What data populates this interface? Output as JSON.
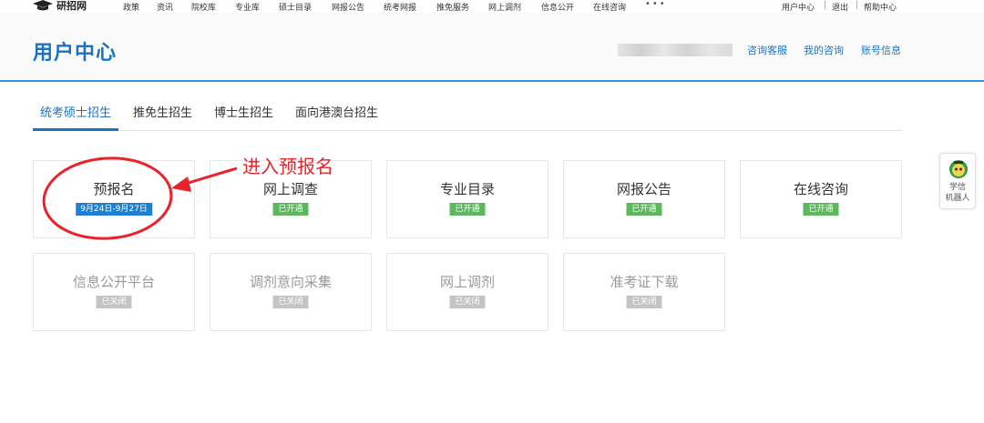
{
  "topnav": {
    "logo_text": "研招网",
    "links": [
      "政策",
      "资讯",
      "院校库",
      "专业库",
      "硕士目录",
      "网报公告",
      "统考网报",
      "推免服务",
      "网上调剂",
      "信息公开",
      "在线咨询"
    ],
    "more": "•••",
    "right": [
      "用户中心",
      "退出",
      "帮助中心"
    ],
    "sep": "|"
  },
  "header": {
    "title": "用户中心",
    "links": [
      "咨询客服",
      "我的咨询",
      "账号信息"
    ]
  },
  "tabs": [
    "统考硕士招生",
    "推免生招生",
    "博士生招生",
    "面向港澳台招生"
  ],
  "active_tab": 0,
  "cards_row1": [
    {
      "name": "预报名",
      "badge": "9月24日-9月27日"
    },
    {
      "name": "网上调查",
      "badge": "已开通"
    },
    {
      "name": "专业目录",
      "badge": "已开通"
    },
    {
      "name": "网报公告",
      "badge": "已开通"
    },
    {
      "name": "在线咨询",
      "badge": "已开通"
    }
  ],
  "cards_row2": [
    {
      "name": "信息公开平台",
      "badge": "已关闭"
    },
    {
      "name": "调剂意向采集",
      "badge": "已关闭"
    },
    {
      "name": "网上调剂",
      "badge": "已关闭"
    },
    {
      "name": "准考证下载",
      "badge": "已关闭"
    }
  ],
  "annotation": {
    "text": "进入预报名",
    "color": "#e8232a"
  },
  "robot": {
    "line1": "学信",
    "line2": "机器人"
  },
  "colors": {
    "brand": "#1b72c0",
    "open": "#5cb85c",
    "closed": "#c4c4c4",
    "date": "#1f7fd0"
  }
}
